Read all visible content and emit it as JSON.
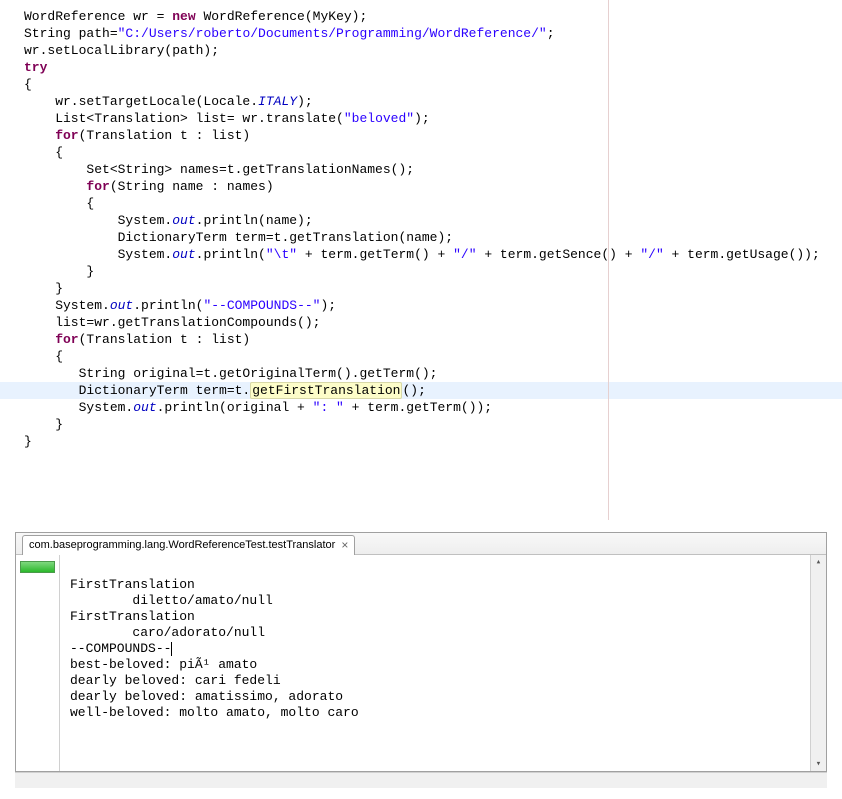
{
  "code": {
    "l1": {
      "a": "WordReference wr = ",
      "kw": "new",
      "b": " WordReference(MyKey);"
    },
    "l2": {
      "a": "String path=",
      "str": "\"C:/Users/roberto/Documents/Programming/WordReference/\"",
      "b": ";"
    },
    "l3": "wr.setLocalLibrary(path);",
    "l4": "try",
    "l5": "{",
    "l6": {
      "a": "    wr.setTargetLocale(Locale.",
      "stat": "ITALY",
      "b": ");"
    },
    "l7": {
      "a": "    List<Translation> list= wr.translate(",
      "str": "\"beloved\"",
      "b": ");"
    },
    "l8": "",
    "l9": {
      "kw": "    for",
      "a": "(Translation t : list)"
    },
    "l10": "    {",
    "l11": "        Set<String> names=t.getTranslationNames();",
    "l12": "",
    "l13": {
      "kw": "        for",
      "a": "(String name : names)"
    },
    "l14": "        {",
    "l15": {
      "a": "            System.",
      "f": "out",
      "b": ".println(name);"
    },
    "l16": "            DictionaryTerm term=t.getTranslation(name);",
    "l17": {
      "a": "            System.",
      "f": "out",
      "b": ".println(",
      "s1": "\"\\t\"",
      "c": " + term.getTerm() + ",
      "s2": "\"/\"",
      "d": " + term.getSence() + ",
      "s3": "\"/\"",
      "e": " + term.getUsage());"
    },
    "l18": "        }",
    "l19": "    }",
    "l20": "",
    "l21": {
      "a": "    System.",
      "f": "out",
      "b": ".println(",
      "s": "\"--COMPOUNDS--\"",
      "c": ");"
    },
    "l22": "    list=wr.getTranslationCompounds();",
    "l23": {
      "kw": "    for",
      "a": "(Translation t : list)"
    },
    "l24": "    {",
    "l25": "       String original=t.getOriginalTerm().getTerm();",
    "l26": {
      "a": "       DictionaryTerm term=t.",
      "hl": "getFirstTranslation",
      "b": "();"
    },
    "l27": {
      "a": "       System.",
      "f": "out",
      "b": ".println(original + ",
      "s": "\": \"",
      "c": " + term.getTerm());"
    },
    "l28": "    }",
    "l29": "}"
  },
  "tab": {
    "label": "com.baseprogramming.lang.WordReferenceTest.testTranslator",
    "close": "×"
  },
  "console": {
    "lines": [
      "FirstTranslation",
      "        diletto/amato/null",
      "FirstTranslation",
      "        caro/adorato/null",
      "--COMPOUNDS--",
      "best-beloved: piÃ¹ amato",
      "dearly beloved: cari fedeli",
      "dearly beloved: amatissimo, adorato",
      "well-beloved: molto amato, molto caro"
    ]
  },
  "scroll": {
    "up": "▴",
    "down": "▾"
  }
}
